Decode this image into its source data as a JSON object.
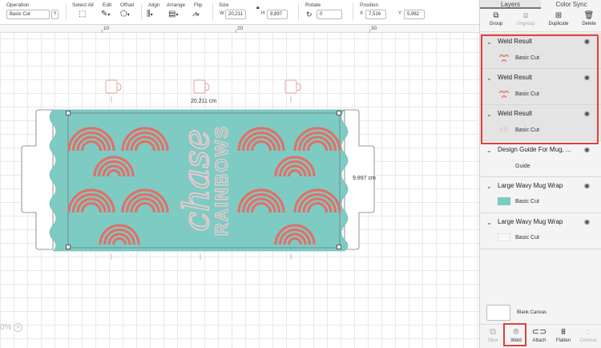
{
  "toolbar": {
    "operation": {
      "label": "Operation",
      "value": "Basic Cut",
      "help": "?"
    },
    "select_all": {
      "label": "Select All"
    },
    "edit": {
      "label": "Edit"
    },
    "offset": {
      "label": "Offset"
    },
    "align": {
      "label": "Align"
    },
    "arrange": {
      "label": "Arrange"
    },
    "flip": {
      "label": "Flip"
    },
    "size": {
      "label": "Size",
      "w_label": "W",
      "w_value": "20,211",
      "h_label": "H",
      "h_value": "9,897"
    },
    "rotate": {
      "label": "Rotate",
      "value": "0"
    },
    "position": {
      "label": "Position",
      "x_label": "X",
      "x_value": "7,516",
      "y_label": "Y",
      "y_value": "5,962"
    }
  },
  "ruler": {
    "ticks": [
      "10",
      "20",
      "30"
    ]
  },
  "canvas": {
    "width_label": "20.211 cm",
    "height_label": "9.897 cm",
    "zoom_value": "0%",
    "design": {
      "script_text": "chase",
      "block_text": "RAINBOWS",
      "colors": {
        "teal": "#7ecbc4",
        "coral": "#e07168",
        "stroke": "#555555",
        "text_pink": "#f4c8cc"
      }
    }
  },
  "panel": {
    "tabs": {
      "layers": "Layers",
      "color_sync": "Color Sync"
    },
    "actions": {
      "group": "Group",
      "ungroup": "Ungroup",
      "duplicate": "Duplicate",
      "delete": "Delete"
    },
    "layers": [
      {
        "title": "Weld Result",
        "child": "Basic Cut"
      },
      {
        "title": "Weld Result",
        "child": "Basic Cut"
      },
      {
        "title": "Weld Result",
        "child": "Basic Cut"
      },
      {
        "title": "Design Guide For Mug, ...",
        "child": "Guide"
      },
      {
        "title": "Large Wavy Mug Wrap",
        "child": "Basic Cut"
      },
      {
        "title": "Large Wavy Mug Wrap",
        "child": "Basic Cut"
      }
    ],
    "blank_canvas": "Blank Canvas",
    "bottom_actions": {
      "slice": "Slice",
      "weld": "Weld",
      "attach": "Attach",
      "flatten": "Flatten",
      "contour": "Contour"
    }
  }
}
